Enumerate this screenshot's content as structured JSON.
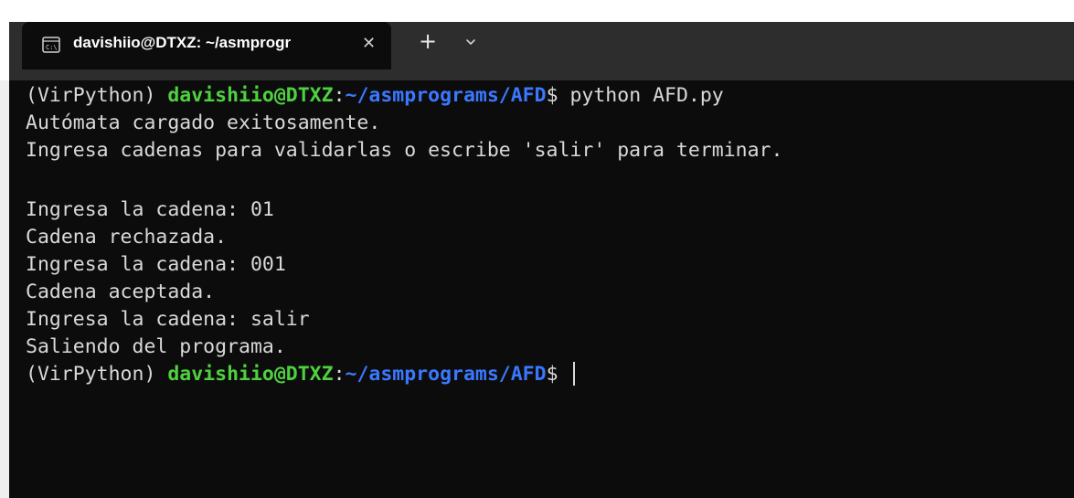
{
  "window": {
    "tab_title": "davishiio@DTXZ: ~/asmprogr",
    "new_tab_label": "+",
    "close_label": "✕"
  },
  "colors": {
    "background": "#0c0c0c",
    "user_host": "#4fd13f",
    "path": "#3a78ff",
    "text": "#d9d9d9"
  },
  "terminal": {
    "prompt": {
      "env": "(VirPython) ",
      "user_host": "davishiio@DTXZ",
      "colon": ":",
      "path": "~/asmprograms/AFD",
      "dollar": "$ "
    },
    "command": "python AFD.py",
    "output": {
      "line1": "Autómata cargado exitosamente.",
      "line2": "Ingresa cadenas para validarlas o escribe 'salir' para terminar.",
      "line3": "Ingresa la cadena: 01",
      "line4": "Cadena rechazada.",
      "line5": "Ingresa la cadena: 001",
      "line6": "Cadena aceptada.",
      "line7": "Ingresa la cadena: salir",
      "line8": "Saliendo del programa."
    }
  }
}
